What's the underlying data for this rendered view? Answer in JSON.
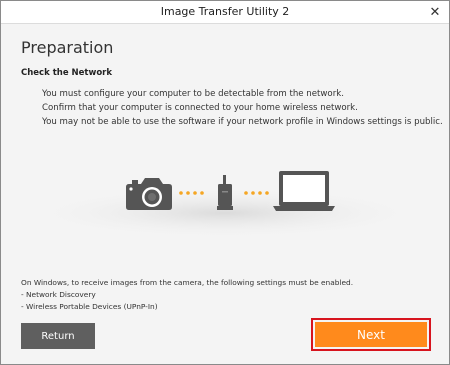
{
  "window": {
    "title": "Image Transfer Utility 2",
    "close_glyph": "✕"
  },
  "page": {
    "heading": "Preparation",
    "subheading": "Check the Network",
    "description": [
      "You must configure your computer to be detectable from the network.",
      "Confirm that your computer is connected to your home wireless network.",
      "You may not be able to use the software if your network profile in Windows settings is public."
    ],
    "illustration": {
      "icons": [
        "camera-icon",
        "wireless-router-icon",
        "laptop-icon"
      ],
      "dot_color": "#f5a623"
    },
    "footnote": [
      "On Windows, to receive images from the camera, the following settings must be enabled.",
      " - Network Discovery",
      " - Wireless Portable Devices (UPnP-In)"
    ]
  },
  "buttons": {
    "return_label": "Return",
    "next_label": "Next"
  },
  "colors": {
    "accent": "#ff8a1c",
    "highlight_border": "#d7141e",
    "secondary_button": "#5f5f5f"
  }
}
